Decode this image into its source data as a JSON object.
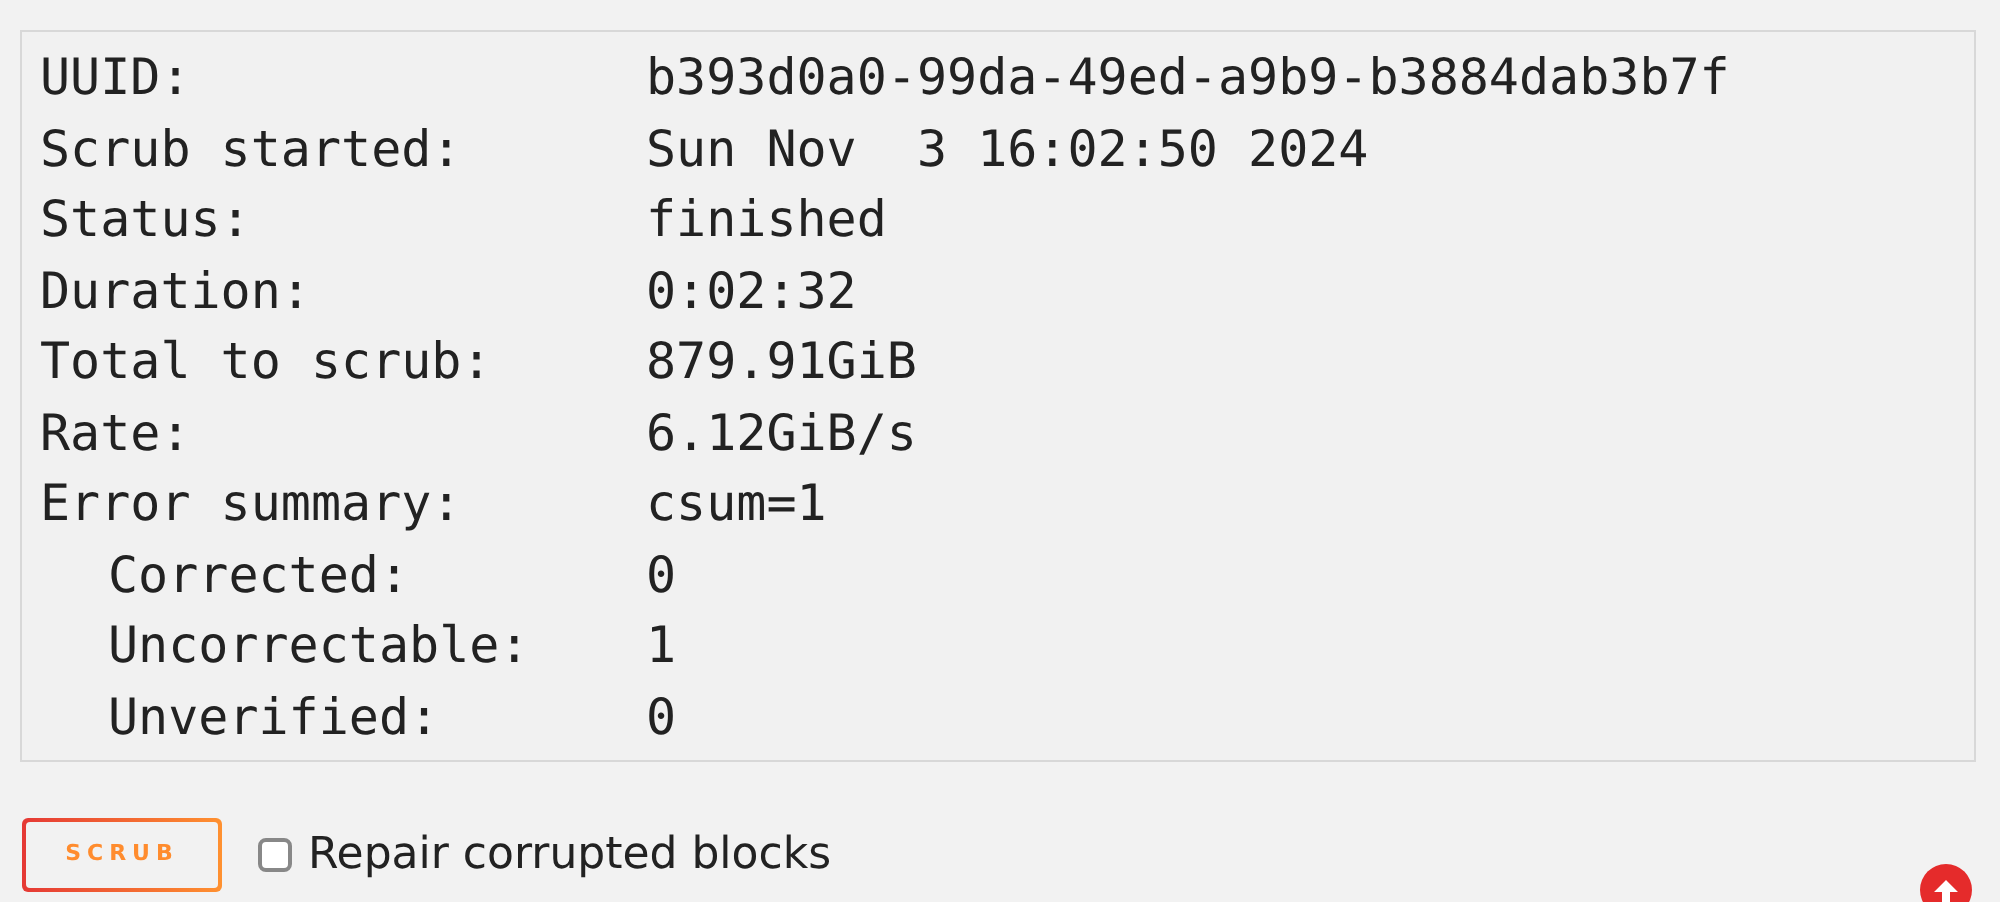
{
  "scrub_output": [
    {
      "label": "UUID:",
      "value": "b393d0a0-99da-49ed-a9b9-b3884dab3b7f"
    },
    {
      "label": "Scrub started:",
      "value": "Sun Nov  3 16:02:50 2024"
    },
    {
      "label": "Status:",
      "value": "finished"
    },
    {
      "label": "Duration:",
      "value": "0:02:32"
    },
    {
      "label": "Total to scrub:",
      "value": "879.91GiB"
    },
    {
      "label": "Rate:",
      "value": "6.12GiB/s"
    },
    {
      "label": "Error summary:",
      "value": "csum=1",
      "children": [
        {
          "label": "Corrected:",
          "value": "0"
        },
        {
          "label": "Uncorrectable:",
          "value": "1"
        },
        {
          "label": "Unverified:",
          "value": "0"
        }
      ]
    }
  ],
  "scrub_button": "SCRUB",
  "repair_option": {
    "label": "Repair corrupted blocks",
    "checked": false
  }
}
